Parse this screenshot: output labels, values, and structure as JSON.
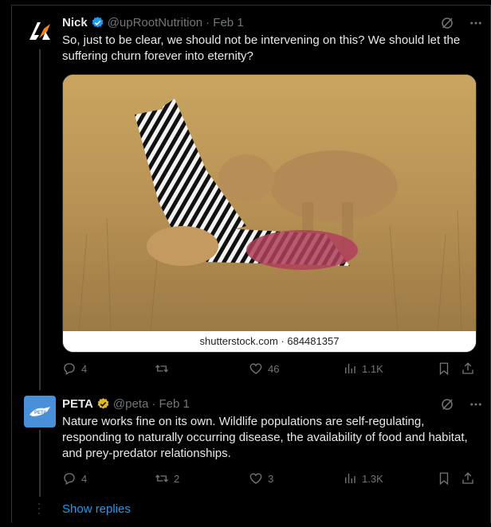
{
  "tweets": [
    {
      "name": "Nick",
      "handle": "@upRootNutrition",
      "date": "· Feb 1",
      "text": "So, just to be clear, we should not be intervening on this? We should let the suffering churn forever into eternity?",
      "media_caption": "shutterstock.com · 684481357",
      "replies": "4",
      "retweets": "",
      "likes": "46",
      "views": "1.1K"
    },
    {
      "name": "PETA",
      "handle": "@peta",
      "date": "· Feb 1",
      "text": "Nature works fine on its own. Wildlife populations are self-regulating, responding to naturally occurring disease, the availability of food and habitat, and prey-predator relationships.",
      "replies": "4",
      "retweets": "2",
      "likes": "3",
      "views": "1.3K"
    }
  ],
  "show_replies": "Show replies",
  "colors": {
    "accent": "#1d9bf0",
    "gold": "#e2b719",
    "muted": "#71767b"
  },
  "icons": [
    "grok-icon",
    "more-icon",
    "reply-icon",
    "retweet-icon",
    "like-icon",
    "views-icon",
    "bookmark-icon",
    "share-icon"
  ]
}
